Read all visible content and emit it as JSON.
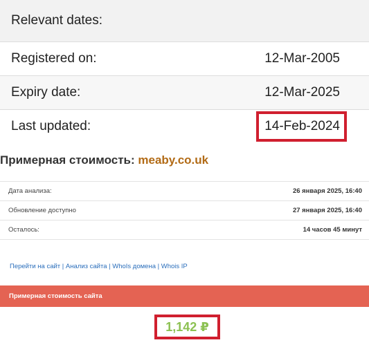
{
  "dates": {
    "header": "Relevant dates:",
    "rows": [
      {
        "label": "Registered on:",
        "value": "12-Mar-2005"
      },
      {
        "label": "Expiry date:",
        "value": "12-Mar-2025"
      },
      {
        "label": "Last updated:",
        "value": "14-Feb-2024"
      }
    ]
  },
  "estimate": {
    "title": "Примерная стоимость:",
    "domain": "meaby.co.uk"
  },
  "info": {
    "rows": [
      {
        "label": "Дата анализа:",
        "value": "26 января 2025, 16:40"
      },
      {
        "label": "Обновление доступно",
        "value": "27 января 2025, 16:40"
      },
      {
        "label": "Осталось:",
        "value": "14 часов 45 минут"
      }
    ]
  },
  "links": {
    "items": [
      "Перейти на сайт",
      "Анализ сайта",
      "WhoIs домена",
      "Whois IP"
    ],
    "separator": "|"
  },
  "bar": {
    "label": "Примерная стоимость сайта"
  },
  "price": {
    "value": "1,142 ₽"
  },
  "colors": {
    "highlight": "#d01f2f",
    "bar": "#e46353",
    "price": "#8cc152",
    "domain": "#b26b16",
    "link": "#2a6ebb"
  }
}
